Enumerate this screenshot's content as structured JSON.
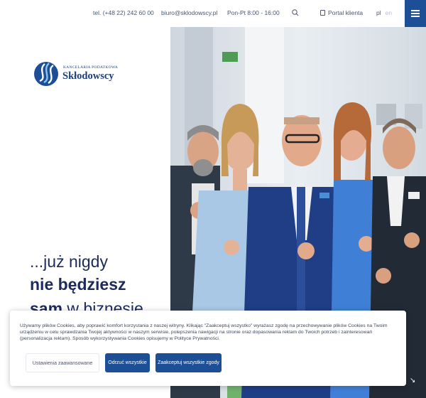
{
  "topbar": {
    "phone": "tel. (+48 22) 242 60 00",
    "email": "biuro@sklodowscy.pl",
    "hours": "Pon-Pt 8:00 - 16:00",
    "search_icon": "search-icon",
    "portal_label": "Portal klienta",
    "portal_icon": "user-icon",
    "lang_active": "pl",
    "lang_other": "en",
    "menu_icon": "hamburger-icon"
  },
  "logo": {
    "small_text": "KANCELARIA PODATKOWA",
    "name": "Skłodowscy"
  },
  "hero": {
    "line1": "...już nigdy",
    "line2": "nie będziesz",
    "line3_bold": "sam",
    "line3_rest": " w biznesie"
  },
  "cookie": {
    "text": "Używamy plików Cookies, aby poprawić komfort korzystania z naszej witryny. Klikając \"Zaakceptuj wszystko\" wyrażasz zgodę na przechowywanie plików Cookies na Twoim urządzeniu w celu sprawdzania Twojej aktywności w naszym serwisie, polepszenia nawigacji na stronie oraz dopasowania reklam do Twoich potrzeb i zainteresowań (personalizacja reklam). Sposób wykorzystywania Cookies opisujemy w Polityce Prywatności.",
    "settings_label": "Ustawienia zaawansowane",
    "reject_label": "Odrzuć wszystkie",
    "accept_label": "Zaakceptuj wszystkie zgody"
  },
  "colors": {
    "brand_blue": "#1c4f96",
    "text_navy": "#1c2b5c"
  }
}
